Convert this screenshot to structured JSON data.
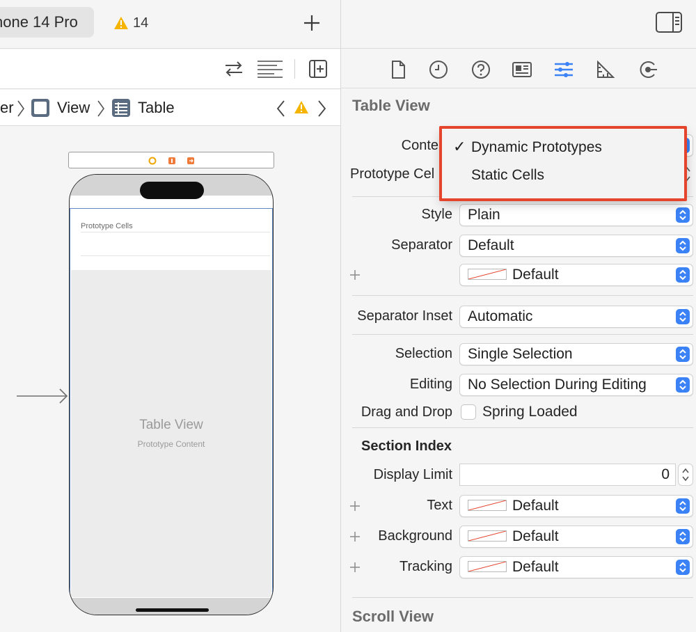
{
  "toolbar": {
    "scheme_device": "hone 14 Pro",
    "warning_count": "14"
  },
  "breadcrumb": {
    "items": [
      "er",
      "View",
      "Table"
    ]
  },
  "canvas": {
    "prototype_cells_header": "Prototype Cells",
    "table_view_title": "Table View",
    "table_view_subtitle": "Prototype Content"
  },
  "inspector": {
    "section_title": "Table View",
    "content_label": "Conte",
    "prototype_cells_label": "Prototype Cel",
    "style_label": "Style",
    "style_value": "Plain",
    "separator_label": "Separator",
    "separator_value": "Default",
    "separator_color_value": "Default",
    "separator_inset_label": "Separator Inset",
    "separator_inset_value": "Automatic",
    "selection_label": "Selection",
    "selection_value": "Single Selection",
    "editing_label": "Editing",
    "editing_value": "No Selection During Editing",
    "drag_drop_label": "Drag and Drop",
    "spring_loaded_label": "Spring Loaded",
    "section_index_title": "Section Index",
    "display_limit_label": "Display Limit",
    "display_limit_value": "0",
    "text_label": "Text",
    "text_value": "Default",
    "background_label": "Background",
    "background_value": "Default",
    "tracking_label": "Tracking",
    "tracking_value": "Default",
    "scroll_view_title": "Scroll View"
  },
  "content_menu": {
    "items": [
      "Dynamic Prototypes",
      "Static Cells"
    ],
    "selected": "Dynamic Prototypes",
    "checkmark": "✓"
  },
  "colors": {
    "accent": "#3b82f6",
    "highlight_border": "#e5432b",
    "warning": "#f5b400",
    "selection_outline": "#5b87c5"
  },
  "icons": [
    "warning-icon",
    "add-icon",
    "swap-icon",
    "lines-icon",
    "add-editor-icon",
    "view-icon",
    "table-icon",
    "file-icon",
    "history-icon",
    "help-icon",
    "identity-icon",
    "attributes-icon",
    "size-icon",
    "connections-icon",
    "sidebar-toggle-icon"
  ]
}
